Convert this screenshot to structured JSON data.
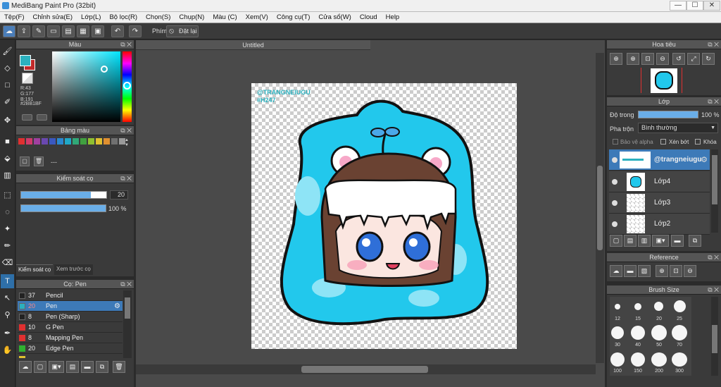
{
  "window": {
    "title": "MediBang Paint Pro (32bit)",
    "minimize": "—",
    "maximize": "☐",
    "close": "✕"
  },
  "menu": [
    "Tệp(F)",
    "Chỉnh sửa(E)",
    "Lớp(L)",
    "Bộ lọc(R)",
    "Chọn(S)",
    "Chụp(N)",
    "Màu (C)",
    "Xem(V)",
    "Công cụ(T)",
    "Cửa sổ(W)",
    "Cloud",
    "Help"
  ],
  "toolbar": {
    "phim_label": "Phím",
    "reset_label": "Đặt lại"
  },
  "color_panel": {
    "title": "Màu",
    "r": "R:43",
    "g": "G:177",
    "b": "B:191",
    "hex": "#2BB1BF",
    "current_color": "#2bb1bf",
    "secondary_color": "#c02a2a"
  },
  "palette_panel": {
    "title": "Bảng màu",
    "name_value": "---",
    "swatches": [
      "#e03030",
      "#d03a6a",
      "#a040a0",
      "#6a48b0",
      "#3a58c0",
      "#2a88d0",
      "#20a8c8",
      "#30a878",
      "#40a040",
      "#90c030",
      "#e0c030",
      "#e09030",
      "#707070",
      "#9a9a9a"
    ]
  },
  "brush_control": {
    "title": "Kiểm soát cọ",
    "size_value": "20",
    "opacity_value": "100 %",
    "size_fraction": 0.82,
    "opacity_fraction": 1.0,
    "tab_control": "Kiểm soát cọ",
    "tab_preview": "Xem trước cọ"
  },
  "brush_list": {
    "title": "Cọ: Pen",
    "items": [
      {
        "size": "37",
        "name": "Pencil",
        "color": "#222222"
      },
      {
        "size": "20",
        "name": "Pen",
        "color": "#2bb1bf",
        "selected": true
      },
      {
        "size": "8",
        "name": "Pen (Sharp)",
        "color": "#222222"
      },
      {
        "size": "10",
        "name": "G Pen",
        "color": "#e03030"
      },
      {
        "size": "8",
        "name": "Mapping Pen",
        "color": "#e03030"
      },
      {
        "size": "20",
        "name": "Edge Pen",
        "color": "#30b030"
      },
      {
        "size": "",
        "name": "",
        "color": "#e0c030"
      }
    ]
  },
  "canvas": {
    "tab_title": "Untitled",
    "watermark_line1": "@TRANGNEIUGU",
    "watermark_line2": "#H247"
  },
  "navigator": {
    "title": "Hoa tiêu"
  },
  "layer_panel": {
    "title": "Lớp",
    "opacity_label": "Độ trong",
    "opacity_value": "100 %",
    "blend_label": "Pha trộn",
    "blend_value": "Bình thường",
    "protect_alpha": "Bảo vệ alpha",
    "clip": "Xén bớt",
    "lock": "Khóa",
    "layers": [
      {
        "name": "@trangneiugu",
        "selected": true
      },
      {
        "name": "Lớp4"
      },
      {
        "name": "Lớp3"
      },
      {
        "name": "Lớp2"
      }
    ]
  },
  "reference_panel": {
    "title": "Reference"
  },
  "brush_size_panel": {
    "title": "Brush Size",
    "sizes": [
      "12",
      "15",
      "20",
      "25",
      "30",
      "40",
      "50",
      "70",
      "100",
      "150",
      "200",
      "300"
    ]
  }
}
